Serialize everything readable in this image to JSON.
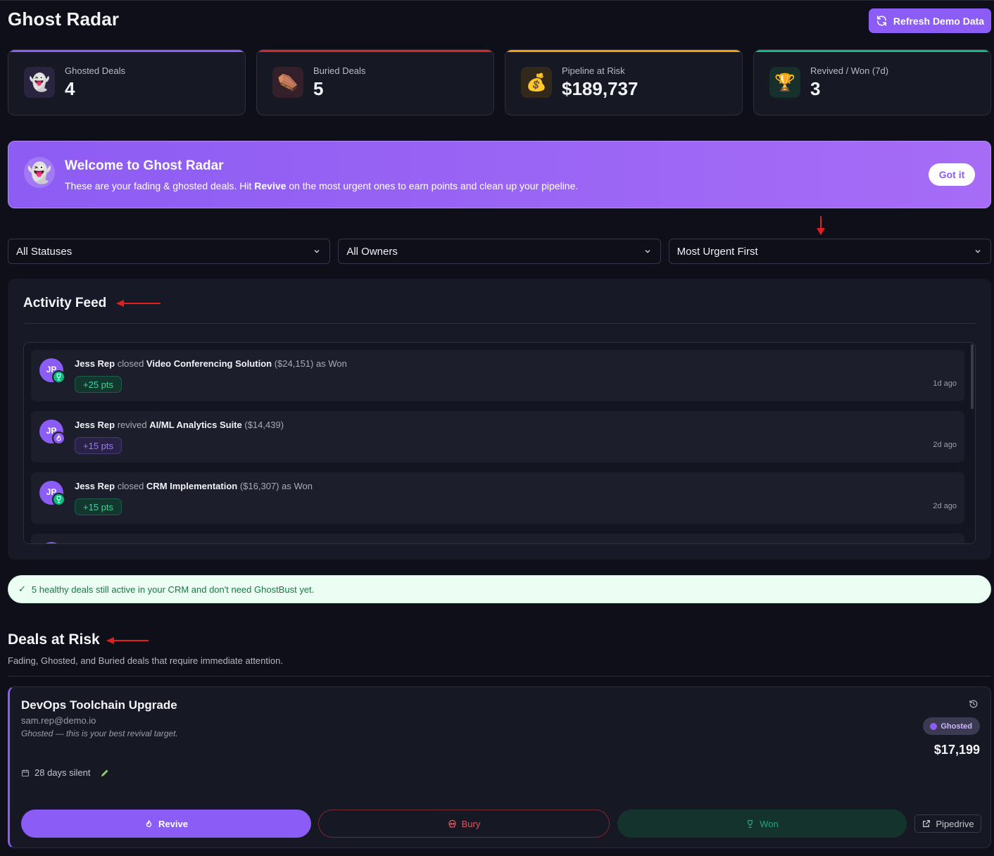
{
  "header": {
    "title": "Ghost Radar",
    "refresh_label": "Refresh Demo Data"
  },
  "stats": [
    {
      "label": "Ghosted Deals",
      "value": "4",
      "icon": "ghost-icon",
      "accent": "#8b5cf6"
    },
    {
      "label": "Buried Deals",
      "value": "5",
      "icon": "coffin-icon",
      "accent": "#dc2626"
    },
    {
      "label": "Pipeline at Risk",
      "value": "$189,737",
      "icon": "money-bag-icon",
      "accent": "#f59e0b"
    },
    {
      "label": "Revived / Won (7d)",
      "value": "3",
      "icon": "trophy-icon",
      "accent": "#10b981"
    }
  ],
  "welcome": {
    "title": "Welcome to Ghost Radar",
    "text_before": "These are your fading & ghosted deals. Hit ",
    "text_bold": "Revive",
    "text_after": " on the most urgent ones to earn points and clean up your pipeline.",
    "button": "Got it"
  },
  "filters": {
    "status": "All Statuses",
    "owner": "All Owners",
    "sort": "Most Urgent First"
  },
  "feed": {
    "title": "Activity Feed",
    "items": [
      {
        "initials": "JP",
        "who": "Jess Rep",
        "verb": "closed",
        "deal": "Video Conferencing Solution",
        "amount": "($24,151)",
        "suffix": "as Won",
        "points": "+25 pts",
        "ago": "1d ago",
        "badge": "trophy-icon",
        "tone": "green"
      },
      {
        "initials": "JP",
        "who": "Jess Rep",
        "verb": "revived",
        "deal": "AI/ML Analytics Suite",
        "amount": "($14,439)",
        "suffix": "",
        "points": "+15 pts",
        "ago": "2d ago",
        "badge": "flame-icon",
        "tone": "purple"
      },
      {
        "initials": "JP",
        "who": "Jess Rep",
        "verb": "closed",
        "deal": "CRM Implementation",
        "amount": "($16,307)",
        "suffix": "as Won",
        "points": "+15 pts",
        "ago": "2d ago",
        "badge": "trophy-icon",
        "tone": "green"
      }
    ]
  },
  "healthy": {
    "check": "✓",
    "text": "5 healthy deals still active in your CRM and don't need GhostBust yet."
  },
  "risk": {
    "title": "Deals at Risk",
    "subtitle": "Fading, Ghosted, and Buried deals that require immediate attention."
  },
  "deal": {
    "name": "DevOps Toolchain Upgrade",
    "owner": "sam.rep@demo.io",
    "note": "Ghosted — this is your best revival target.",
    "silent": "28 days silent",
    "status": "Ghosted",
    "value": "$17,199",
    "actions": {
      "revive": "Revive",
      "bury": "Bury",
      "won": "Won",
      "pipedrive": "Pipedrive"
    }
  },
  "colors": {
    "accent": "#8b5cf6",
    "background": "#0e0f19",
    "annotation_arrow": "#e0201f"
  }
}
